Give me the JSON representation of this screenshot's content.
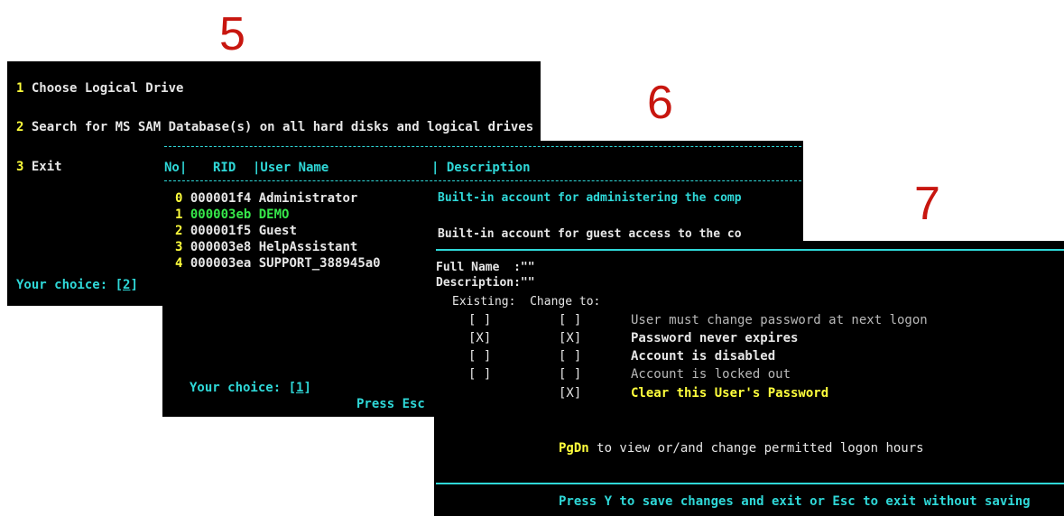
{
  "steps": [
    "5",
    "6",
    "7"
  ],
  "screen5": {
    "options": [
      {
        "num": "1",
        "text": " Choose Logical Drive"
      },
      {
        "num": "2",
        "text": " Search for MS SAM Database(s) on all hard disks and logical drives"
      },
      {
        "num": "3",
        "text": " Exit"
      }
    ],
    "choice_label": "Your choice: [",
    "choice_value": "2",
    "choice_end": "]"
  },
  "screen6": {
    "header": {
      "no": "No|",
      "rid": "RID",
      "user": "|User Name",
      "desc": "| Description"
    },
    "users": [
      {
        "no": "0",
        "rid": "000001f4",
        "name": "Administrator",
        "color": "#e6e6e6"
      },
      {
        "no": "1",
        "rid": "000003eb",
        "name": "DEMO",
        "color": "#36e84a"
      },
      {
        "no": "2",
        "rid": "000001f5",
        "name": "Guest",
        "color": "#e6e6e6"
      },
      {
        "no": "3",
        "rid": "000003e8",
        "name": "HelpAssistant",
        "color": "#e6e6e6"
      },
      {
        "no": "4",
        "rid": "000003ea",
        "name": "SUPPORT_388945a0",
        "color": "#e6e6e6"
      }
    ],
    "descriptions": [
      "Built-in account for administering the comp",
      "Built-in account for guest access to the co"
    ],
    "choice_label": "Your choice: [",
    "choice_value": "1",
    "choice_end": "]",
    "press_esc": "Press Esc"
  },
  "screen7": {
    "full_name": "Full Name  :\"\"",
    "description": "Description:\"\"",
    "columns_label": "Existing:  Change to:",
    "flags": [
      {
        "existing": "[ ]",
        "change": "[ ]",
        "label": "User must change password at next logon",
        "color": "#b8b8b8"
      },
      {
        "existing": "[X]",
        "change": "[X]",
        "label": "Password never expires",
        "color": "#e6e6e6"
      },
      {
        "existing": "[ ]",
        "change": "[ ]",
        "label": "Account is disabled",
        "color": "#e6e6e6"
      },
      {
        "existing": "[ ]",
        "change": "[ ]",
        "label": "Account is locked out",
        "color": "#b8b8b8"
      },
      {
        "existing": "",
        "change": "[X]",
        "label": "Clear this User's Password",
        "color": "#ffff3c"
      }
    ],
    "pgdn_key": "PgDn",
    "pgdn_text": " to view or/and change permitted logon hours",
    "save_text": "Press Y to save changes and exit or Esc to exit without saving"
  }
}
